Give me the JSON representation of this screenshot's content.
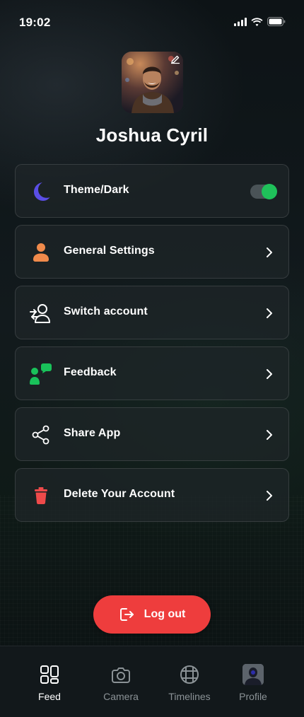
{
  "status_bar": {
    "time": "19:02"
  },
  "profile": {
    "name": "Joshua Cyril"
  },
  "menu": [
    {
      "label": "Theme/Dark",
      "icon": "moon-icon",
      "type": "toggle",
      "toggle_on": true
    },
    {
      "label": "General Settings",
      "icon": "user-icon",
      "type": "link"
    },
    {
      "label": "Switch account",
      "icon": "switch-account-icon",
      "type": "link"
    },
    {
      "label": "Feedback",
      "icon": "feedback-icon",
      "type": "link"
    },
    {
      "label": "Share App",
      "icon": "share-icon",
      "type": "link"
    },
    {
      "label": "Delete Your Account",
      "icon": "trash-icon",
      "type": "link"
    }
  ],
  "logout": {
    "label": "Log out"
  },
  "bottom_nav": [
    {
      "label": "Feed",
      "icon": "grid-icon",
      "active": true
    },
    {
      "label": "Camera",
      "icon": "camera-icon",
      "active": false
    },
    {
      "label": "Timelines",
      "icon": "film-icon",
      "active": false
    },
    {
      "label": "Profile",
      "icon": "profile-avatar",
      "active": false
    }
  ],
  "colors": {
    "accent_green": "#1fc15a",
    "logout_red": "#ee3d3d",
    "moon_purple": "#5a4ee6",
    "user_orange": "#f08a4b",
    "feedback_green": "#19c25a",
    "trash_red": "#ef4a4a"
  }
}
